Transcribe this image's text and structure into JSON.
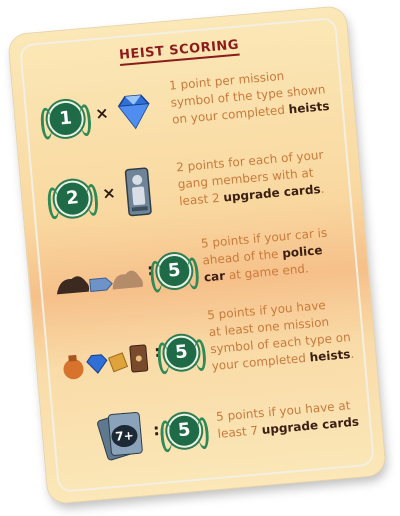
{
  "card": {
    "title": "HEIST SCORING",
    "rows": [
      {
        "badge": "1",
        "operator": "×",
        "icon": "diamond-icon",
        "line1": "1 point per mission",
        "line2": "symbol of the type shown",
        "line3_pre": "on your completed ",
        "line3_bold": "heists"
      },
      {
        "badge": "2",
        "operator": "×",
        "icon": "gang-member-icon",
        "line1": "2 points for each of your",
        "line2": "gang members with at",
        "line3_pre": "least 2 ",
        "line3_bold": "upgrade cards",
        "line3_post": "."
      },
      {
        "badge": "5",
        "operator": ":",
        "icon": "car-ahead-icon",
        "line1": "5 points if your car is",
        "line2_pre": "ahead of the ",
        "line2_bold": "police",
        "line3_bold": "car",
        "line3_post": " at game end."
      },
      {
        "badge": "5",
        "operator": ":",
        "icon": "mission-symbols-icon",
        "line1": "5 points if you have",
        "line2": "at least one mission",
        "line3": "symbol of each type on",
        "line4_pre": "your completed ",
        "line4_bold": "heists",
        "line4_post": "."
      },
      {
        "badge": "5",
        "operator": ":",
        "icon": "cards-7-icon",
        "cards_label": "7+",
        "line1": "5 points if you have at",
        "line2_pre": "least 7 ",
        "line2_bold": "upgrade cards"
      }
    ]
  },
  "colors": {
    "title": "#8a1c1c",
    "text": "#c97a3c",
    "bold_text": "#3a1f12",
    "badge": "#1f6b47"
  }
}
